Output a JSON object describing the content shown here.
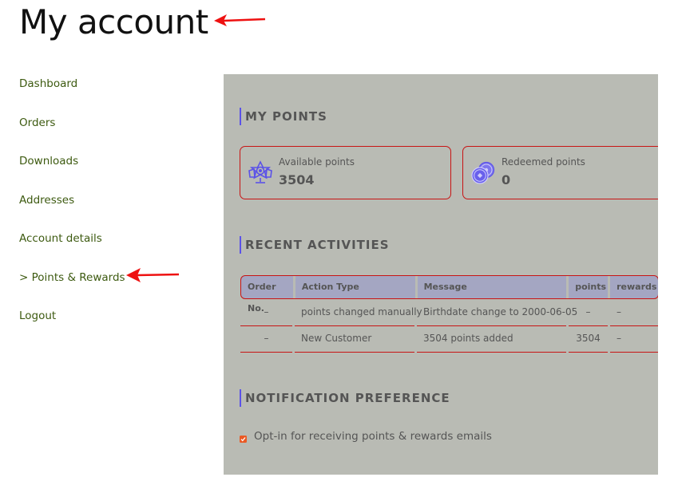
{
  "page": {
    "title": "My account"
  },
  "nav": {
    "items": [
      {
        "label": "Dashboard"
      },
      {
        "label": "Orders"
      },
      {
        "label": "Downloads"
      },
      {
        "label": "Addresses"
      },
      {
        "label": "Account details"
      },
      {
        "label": "> Points & Rewards",
        "active": true
      },
      {
        "label": "Logout"
      }
    ]
  },
  "points_section": {
    "title": "MY POINTS",
    "available": {
      "label": "Available points",
      "value": "3504",
      "icon": "star-badge-icon"
    },
    "redeemed": {
      "label": "Redeemed points",
      "value": "0",
      "icon": "coins-icon"
    }
  },
  "activities_section": {
    "title": "RECENT ACTIVITIES",
    "columns": [
      "Order No.",
      "Action Type",
      "Message",
      "points",
      "rewards"
    ],
    "rows": [
      [
        "–",
        "points changed manually",
        "Birthdate change to 2000-06-05",
        "–",
        "–"
      ],
      [
        "–",
        "New Customer",
        "3504 points added",
        "3504",
        "–"
      ]
    ]
  },
  "notification_section": {
    "title": "NOTIFICATION PREFERENCE",
    "optin_label": "Opt-in for receiving points & rewards emails",
    "optin_checked": true
  },
  "colors": {
    "panel_bg": "#b9bbb4",
    "accent_border": "#c81414",
    "section_bar": "#5b52e8",
    "table_header": "#a4a6c2",
    "nav_link": "#3d5a10",
    "checkbox": "#ea5a25",
    "annotation_arrow": "#ee1111"
  }
}
